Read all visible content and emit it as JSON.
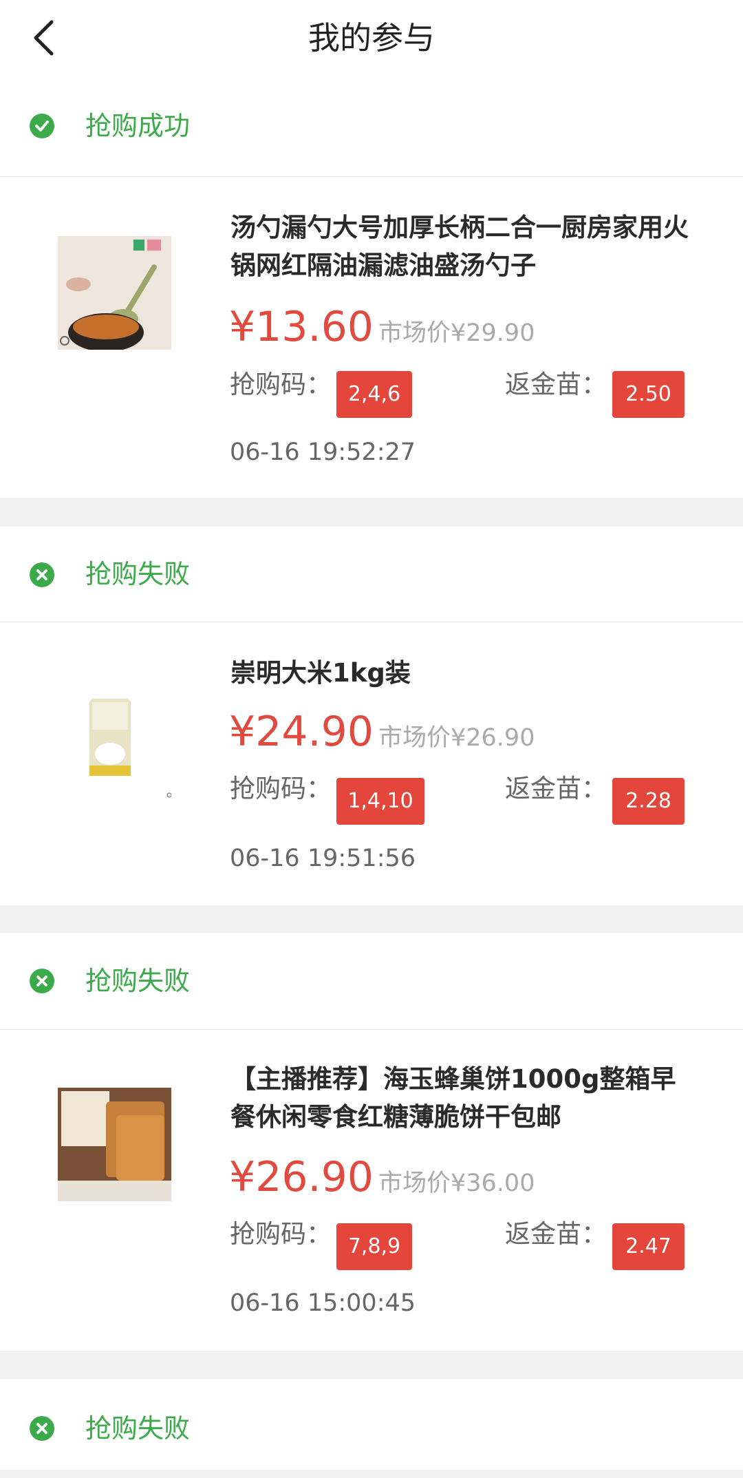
{
  "header": {
    "title": "我的参与"
  },
  "records": [
    {
      "status": "抢购成功",
      "status_kind": "success",
      "title": "汤勺漏勺大号加厚长柄二合一厨房家用火锅网红隔油漏滤油盛汤勺子",
      "price": "¥13.60",
      "market_price": "市场价¥29.90",
      "code_label": "抢购码：",
      "code": "2,4,6",
      "miao_label": "返金苗：",
      "miao": "2.50",
      "time": "06-16 19:52:27"
    },
    {
      "status": "抢购失败",
      "status_kind": "fail",
      "title": "崇明大米1kg装",
      "price": "¥24.90",
      "market_price": "市场价¥26.90",
      "code_label": "抢购码：",
      "code": "1,4,10",
      "miao_label": "返金苗：",
      "miao": "2.28",
      "time": "06-16 19:51:56"
    },
    {
      "status": "抢购失败",
      "status_kind": "fail",
      "title": "【主播推荐】海玉蜂巢饼1000g整箱早餐休闲零食红糖薄脆饼干包邮",
      "price": "¥26.90",
      "market_price": "市场价¥36.00",
      "code_label": "抢购码：",
      "code": "7,8,9",
      "miao_label": "返金苗：",
      "miao": "2.47",
      "time": "06-16 15:00:45"
    },
    {
      "status": "抢购失败",
      "status_kind": "fail"
    }
  ],
  "colors": {
    "success": "#3bab4a",
    "price": "#e04a3f",
    "tag": "#e4463c"
  }
}
